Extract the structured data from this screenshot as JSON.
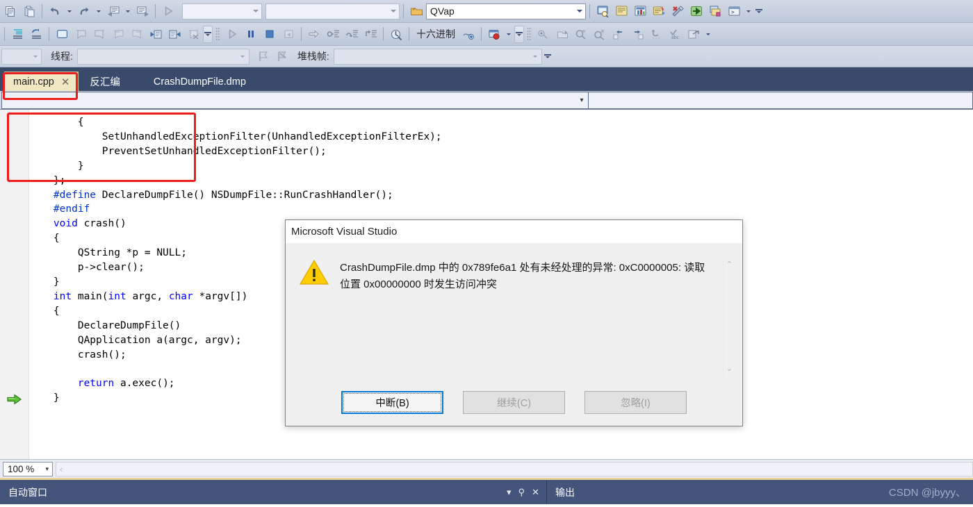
{
  "toolbar_row1": {
    "icons": [
      "copy-icon",
      "paste-icon",
      "undo-icon",
      "undo-dropdown-icon",
      "redo-icon",
      "redo-dropdown-icon",
      "navigate-backward-icon",
      "navigate-backward-dropdown-icon",
      "navigate-forward-icon",
      "start-debug-icon"
    ],
    "config_combo": {
      "value": "",
      "placeholder": ""
    },
    "platform_combo": {
      "value": "",
      "placeholder": ""
    },
    "startup_project_combo": {
      "value": "QVap",
      "placeholder": ""
    },
    "right_icons": [
      "find-in-window-icon",
      "properties-window-icon",
      "toolbox-icon",
      "solution-explorer-icon",
      "tools-options-icon",
      "export-icon",
      "class-view-icon",
      "command-window-icon"
    ],
    "overflow_label": "more-toolbar-buttons"
  },
  "toolbar_row2": {
    "left_icons": [
      "indent-guides-icon",
      "undo-indent-icon"
    ],
    "bookmark_icons": [
      "new-bookmark-icon",
      "prev-bookmark-icon",
      "next-bookmark-icon",
      "prev-bookmark-folder-icon",
      "next-bookmark-folder-icon",
      "prev-bookmark-in-file-icon",
      "next-bookmark-in-file-icon",
      "clear-bookmarks-icon"
    ],
    "debug_icons": [
      "continue-icon",
      "break-all-icon",
      "stop-debugging-icon",
      "restart-icon"
    ],
    "step_icons": [
      "show-next-statement-icon",
      "step-into-icon",
      "step-over-icon",
      "step-out-icon"
    ],
    "hex_toggle_icon": "hex-display-icon",
    "hex_label": "十六进制",
    "thread_marker_icon": "thread-marker-icon",
    "breakpoint_icon": "breakpoints-icon",
    "breakpoint_dropdown_icon": "breakpoints-dropdown-icon",
    "right_icons": [
      "immediate-window-icon",
      "watch-window-icon",
      "locals-window-icon",
      "quickwatch-icon",
      "step-into-specific-icon",
      "step-over-specific-icon",
      "set-next-statement-icon",
      "spell-check-icon",
      "external-code-icon"
    ]
  },
  "toolbar_row3": {
    "process_combo": {
      "value": "",
      "placeholder": ""
    },
    "thread_label": "线程:",
    "thread_combo": {
      "value": "",
      "placeholder": ""
    },
    "flag_icons": [
      "flag-thread-icon",
      "unflag-thread-icon"
    ],
    "stackframe_label": "堆栈帧:",
    "stackframe_combo": {
      "value": "",
      "placeholder": ""
    }
  },
  "tabs": [
    {
      "label": "main.cpp",
      "active": true,
      "closable": true,
      "close_glyph": "✕"
    },
    {
      "label": "反汇编",
      "active": false,
      "closable": false
    },
    {
      "label": "CrashDumpFile.dmp",
      "active": false,
      "closable": false
    }
  ],
  "navbar": {
    "scope_combo": {
      "value": "",
      "placeholder": ""
    },
    "member_combo": {
      "value": "",
      "placeholder": ""
    },
    "arrow_glyph": "▾"
  },
  "editor": {
    "current_line_marker_icon": "current-statement-arrow-icon",
    "lines": [
      {
        "indent": 4,
        "parts": [
          {
            "t": "{",
            "c": "plain"
          }
        ]
      },
      {
        "indent": 8,
        "parts": [
          {
            "t": "SetUnhandledExceptionFilter(UnhandledExceptionFilterEx);",
            "c": "plain"
          }
        ]
      },
      {
        "indent": 8,
        "parts": [
          {
            "t": "PreventSetUnhandledExceptionFilter();",
            "c": "plain"
          }
        ]
      },
      {
        "indent": 4,
        "parts": [
          {
            "t": "}",
            "c": "plain"
          }
        ]
      },
      {
        "indent": 0,
        "parts": [
          {
            "t": "};",
            "c": "plain"
          }
        ]
      },
      {
        "indent": 0,
        "parts": [
          {
            "t": "#define",
            "c": "pre"
          },
          {
            "t": " DeclareDumpFile() NSDumpFile::RunCrashHandler();",
            "c": "plain"
          }
        ]
      },
      {
        "indent": 0,
        "parts": [
          {
            "t": "#endif",
            "c": "pre"
          }
        ]
      },
      {
        "indent": 0,
        "parts": [
          {
            "t": "void",
            "c": "kw"
          },
          {
            "t": " crash()",
            "c": "plain"
          }
        ]
      },
      {
        "indent": 0,
        "parts": [
          {
            "t": "{",
            "c": "plain"
          }
        ]
      },
      {
        "indent": 4,
        "parts": [
          {
            "t": "QString *p = NULL;",
            "c": "plain"
          }
        ]
      },
      {
        "indent": 4,
        "parts": [
          {
            "t": "p->clear();",
            "c": "plain"
          }
        ]
      },
      {
        "indent": 0,
        "parts": [
          {
            "t": "}",
            "c": "plain"
          }
        ]
      },
      {
        "indent": 0,
        "parts": [
          {
            "t": "int",
            "c": "kw"
          },
          {
            "t": " main(",
            "c": "plain"
          },
          {
            "t": "int",
            "c": "kw"
          },
          {
            "t": " argc, ",
            "c": "plain"
          },
          {
            "t": "char",
            "c": "kw"
          },
          {
            "t": " *argv[])",
            "c": "plain"
          }
        ]
      },
      {
        "indent": 0,
        "parts": [
          {
            "t": "{",
            "c": "plain"
          }
        ]
      },
      {
        "indent": 4,
        "parts": [
          {
            "t": "DeclareDumpFile()",
            "c": "plain"
          }
        ]
      },
      {
        "indent": 4,
        "parts": [
          {
            "t": "QApplication a(argc, argv);",
            "c": "plain"
          }
        ]
      },
      {
        "indent": 4,
        "parts": [
          {
            "t": "crash();",
            "c": "plain"
          }
        ]
      },
      {
        "indent": 0,
        "parts": [
          {
            "t": "",
            "c": "plain"
          }
        ]
      },
      {
        "indent": 4,
        "parts": [
          {
            "t": "return",
            "c": "kw"
          },
          {
            "t": " a.exec();",
            "c": "plain"
          }
        ]
      },
      {
        "indent": 0,
        "parts": [
          {
            "t": "}",
            "c": "plain"
          }
        ]
      }
    ],
    "annotations": [
      {
        "name": "tab-highlight-box"
      },
      {
        "name": "crash-function-highlight-box"
      }
    ]
  },
  "dialog": {
    "title": "Microsoft Visual Studio",
    "icon": "warning-triangle-icon",
    "message": "CrashDumpFile.dmp 中的 0x789fe6a1 处有未经处理的异常: 0xC0000005: 读取位置 0x00000000 时发生访问冲突",
    "scroll_up_glyph": "⌃",
    "scroll_down_glyph": "⌄",
    "buttons": [
      {
        "label": "中断(B)",
        "accel": "B",
        "text_before": "中断(",
        "text_after": ")",
        "state": "focused"
      },
      {
        "label": "继续(C)",
        "accel": "C",
        "text_before": "继续(",
        "text_after": ")",
        "state": "disabled"
      },
      {
        "label": "忽略(I)",
        "accel": "I",
        "text_before": "忽略(",
        "text_after": ")",
        "state": "disabled"
      }
    ]
  },
  "status": {
    "zoom_value": "100 %",
    "zoom_arrow": "▾",
    "splitter_chevron": "‹"
  },
  "bottom_panels": {
    "autos_tab": "自动窗口",
    "autos_controls": {
      "dropdown_glyph": "▾",
      "pin_glyph": "⚲",
      "close_glyph": "✕"
    },
    "output_tab": "输出",
    "watermark": "CSDN @jbyyy、"
  },
  "colors": {
    "accent_blue": "#0078d7",
    "annotation_red": "#ef1c1c",
    "tab_active_bg": "#f2e7c4",
    "panel_navy": "#3a4a6b",
    "keyword_blue": "#0000ff",
    "warning_yellow": "#ffcc00"
  }
}
